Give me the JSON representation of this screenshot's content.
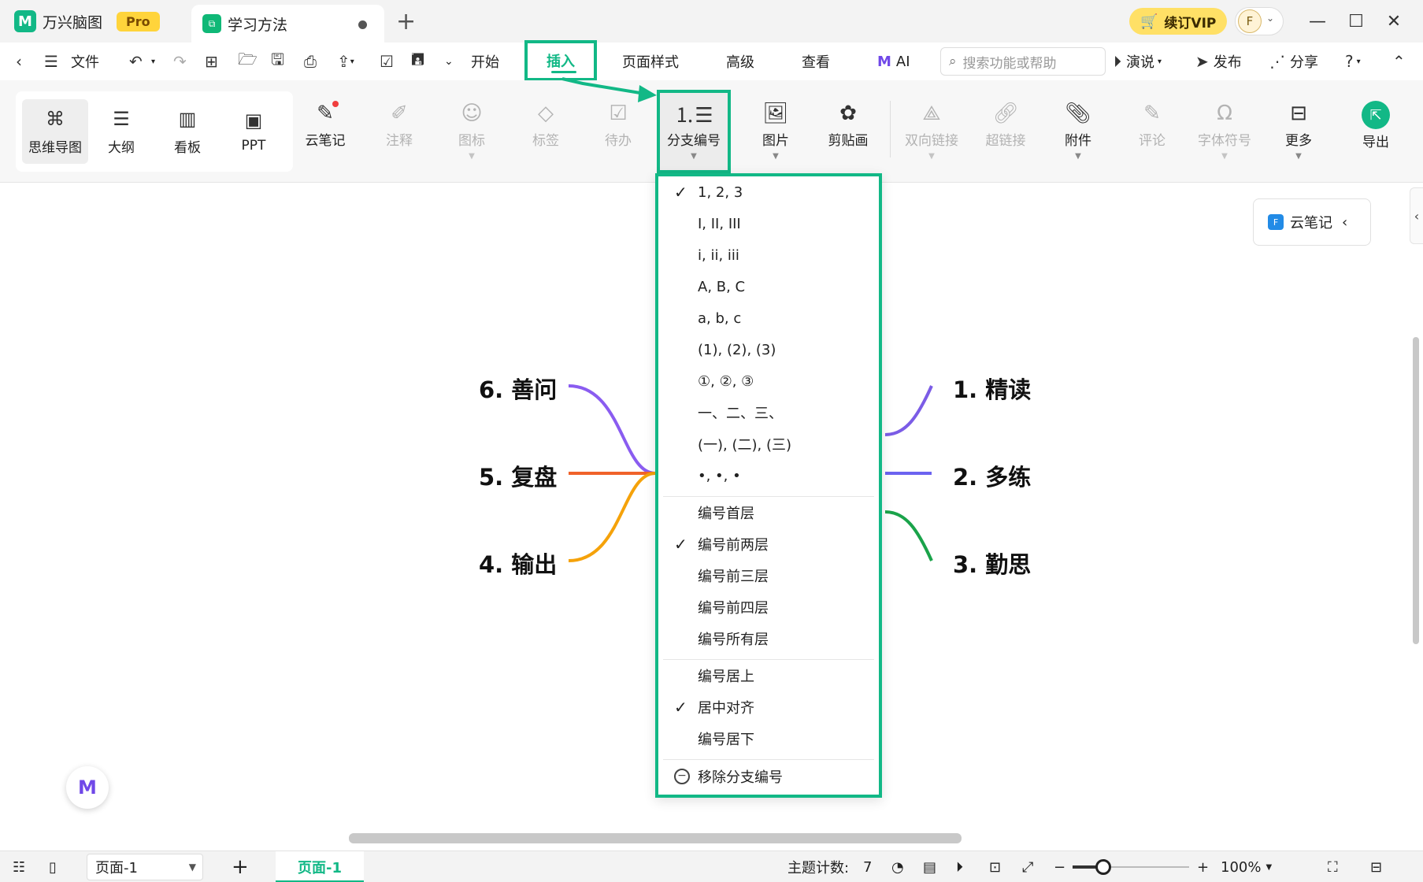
{
  "titlebar": {
    "app_name": "万兴脑图",
    "pro_badge": "Pro",
    "doc_tab": "学习方法",
    "vip_button": "续订VIP",
    "avatar_letter": "F"
  },
  "menubar": {
    "file": "文件",
    "start": "开始",
    "insert": "插入",
    "page_style": "页面样式",
    "advanced": "高级",
    "view": "查看",
    "ai": "AI",
    "search_placeholder": "搜索功能或帮助",
    "present": "演说",
    "publish": "发布",
    "share": "分享"
  },
  "ribbon": {
    "views": [
      "思维导图",
      "大纲",
      "看板",
      "PPT"
    ],
    "cloud_note": "云笔记",
    "note": "注释",
    "icon": "图标",
    "tag": "标签",
    "todo": "待办",
    "branch_numbering": "分支编号",
    "image": "图片",
    "clipart": "剪贴画",
    "bilink": "双向链接",
    "hyperlink": "超链接",
    "attachment": "附件",
    "comment": "评论",
    "symbol": "字体符号",
    "more": "更多",
    "export": "导出"
  },
  "mindmap": {
    "nodes": [
      "1. 精读",
      "2. 多练",
      "3. 勤思",
      "4. 输出",
      "5. 复盘",
      "6. 善问"
    ],
    "colors": {
      "purple": "#7b5ce6",
      "blue": "#6c63f0",
      "green": "#1aa34a",
      "orange": "#f5a20a",
      "red_orange": "#f0622a",
      "violet": "#8a5cf0"
    }
  },
  "cloud_note_panel": "云笔记",
  "dropdown": {
    "formats": [
      "1, 2, 3",
      "I, II, III",
      "i, ii, iii",
      "A, B, C",
      "a, b, c",
      "(1), (2), (3)",
      "①, ②, ③",
      "一、二、三、",
      "(一), (二), (三)",
      "•, •, •"
    ],
    "levels": [
      "编号首层",
      "编号前两层",
      "编号前三层",
      "编号前四层",
      "编号所有层"
    ],
    "alignment": [
      "编号居上",
      "居中对齐",
      "编号居下"
    ],
    "remove": "移除分支编号",
    "checked_format": "1, 2, 3",
    "checked_level": "编号前两层",
    "checked_alignment": "居中对齐"
  },
  "statusbar": {
    "page_select": "页面-1",
    "page_tab": "页面-1",
    "topic_count_label": "主题计数:",
    "topic_count": "7",
    "zoom": "100%"
  },
  "accent_color": "#12b886"
}
